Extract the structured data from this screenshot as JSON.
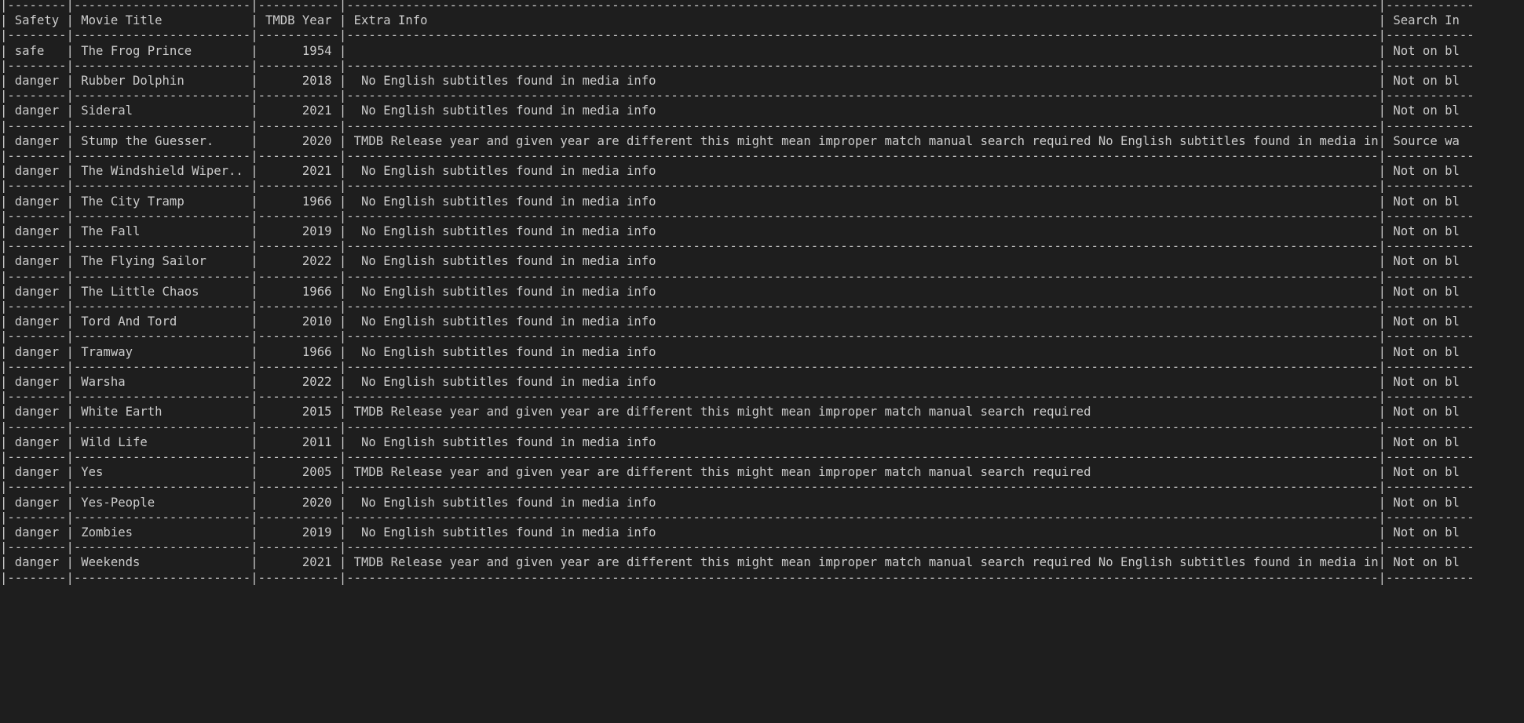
{
  "table": {
    "columns": {
      "safety": "Safety",
      "title": "Movie Title",
      "year": "TMDB Year",
      "extra": "Extra Info",
      "search": "Search In"
    },
    "rows": [
      {
        "safety": "safe",
        "title": "The Frog Prince",
        "year": "1954",
        "extra": "",
        "search": "Not on bl"
      },
      {
        "safety": "danger",
        "title": "Rubber Dolphin",
        "year": "2018",
        "extra": " No English subtitles found in media info",
        "search": "Not on bl"
      },
      {
        "safety": "danger",
        "title": "Sideral",
        "year": "2021",
        "extra": " No English subtitles found in media info",
        "search": "Not on bl"
      },
      {
        "safety": "danger",
        "title": "Stump the Guesser.",
        "year": "2020",
        "extra": "TMDB Release year and given year are different this might mean improper match manual search required No English subtitles found in media info",
        "search": "Source wa"
      },
      {
        "safety": "danger",
        "title": "The Windshield Wiper..",
        "year": "2021",
        "extra": " No English subtitles found in media info",
        "search": "Not on bl"
      },
      {
        "safety": "danger",
        "title": "The City Tramp",
        "year": "1966",
        "extra": " No English subtitles found in media info",
        "search": "Not on bl"
      },
      {
        "safety": "danger",
        "title": "The Fall",
        "year": "2019",
        "extra": " No English subtitles found in media info",
        "search": "Not on bl"
      },
      {
        "safety": "danger",
        "title": "The Flying Sailor",
        "year": "2022",
        "extra": " No English subtitles found in media info",
        "search": "Not on bl"
      },
      {
        "safety": "danger",
        "title": "The Little Chaos",
        "year": "1966",
        "extra": " No English subtitles found in media info",
        "search": "Not on bl"
      },
      {
        "safety": "danger",
        "title": "Tord And Tord",
        "year": "2010",
        "extra": " No English subtitles found in media info",
        "search": "Not on bl"
      },
      {
        "safety": "danger",
        "title": "Tramway",
        "year": "1966",
        "extra": " No English subtitles found in media info",
        "search": "Not on bl"
      },
      {
        "safety": "danger",
        "title": "Warsha",
        "year": "2022",
        "extra": " No English subtitles found in media info",
        "search": "Not on bl"
      },
      {
        "safety": "danger",
        "title": "White Earth",
        "year": "2015",
        "extra": "TMDB Release year and given year are different this might mean improper match manual search required",
        "search": "Not on bl"
      },
      {
        "safety": "danger",
        "title": "Wild Life",
        "year": "2011",
        "extra": " No English subtitles found in media info",
        "search": "Not on bl"
      },
      {
        "safety": "danger",
        "title": "Yes",
        "year": "2005",
        "extra": "TMDB Release year and given year are different this might mean improper match manual search required",
        "search": "Not on bl"
      },
      {
        "safety": "danger",
        "title": "Yes-People",
        "year": "2020",
        "extra": " No English subtitles found in media info",
        "search": "Not on bl"
      },
      {
        "safety": "danger",
        "title": "Zombies",
        "year": "2019",
        "extra": " No English subtitles found in media info",
        "search": "Not on bl"
      },
      {
        "safety": "danger",
        "title": "Weekends",
        "year": "2021",
        "extra": "TMDB Release year and given year are different this might mean improper match manual search required No English subtitles found in media info",
        "search": "Not on bl"
      }
    ]
  },
  "colors": {
    "background": "#1e1e1e",
    "text": "#cccccc"
  }
}
